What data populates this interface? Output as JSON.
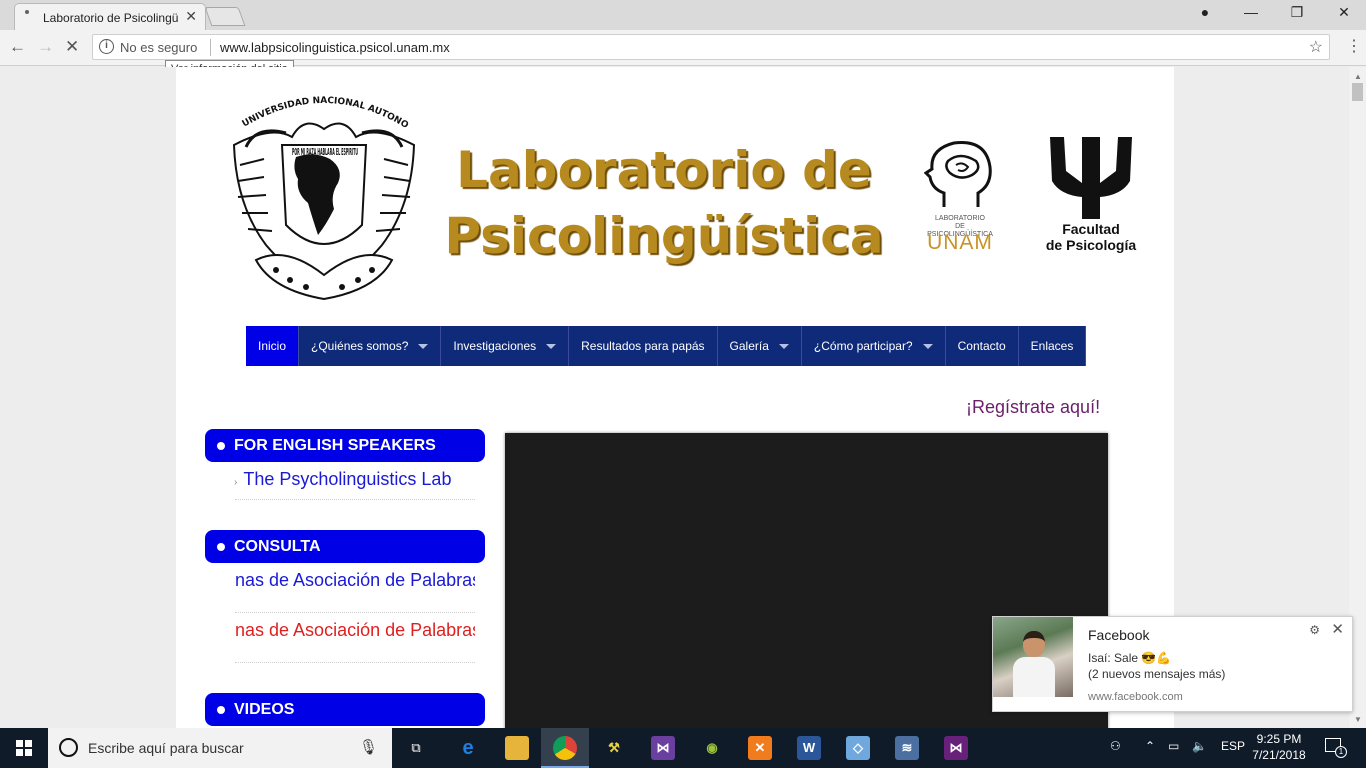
{
  "browser": {
    "tab_title": "Laboratorio de Psicolingü",
    "security_label": "No es seguro",
    "url": "www.labpsicolinguistica.psicol.unam.mx",
    "tooltip": "Ver información del sitio"
  },
  "header": {
    "title_line1": "Laboratorio de",
    "title_line2": "Psicolingüística",
    "seal_text_top": "UNIVERSIDAD NACIONAL AUTONOMA DE MEXICO",
    "seal_motto": "POR MI RAZA HABLARA EL ESPIRITU",
    "lab_logo_caption_line1": "LABORATORIO",
    "lab_logo_caption_line2": "DE PSICOLINGÜÍSTICA",
    "lab_logo_unam": "UNAM",
    "faculty_line1": "Facultad",
    "faculty_line2": "de Psicología"
  },
  "nav": {
    "items": [
      {
        "label": "Inicio"
      },
      {
        "label": "¿Quiénes somos?"
      },
      {
        "label": "Investigaciones"
      },
      {
        "label": "Resultados para papás"
      },
      {
        "label": "Galería"
      },
      {
        "label": "¿Cómo participar?"
      },
      {
        "label": "Contacto"
      },
      {
        "label": "Enlaces"
      }
    ]
  },
  "register_link": "¡Regístrate aquí!",
  "sidebar": {
    "english_heading": "FOR ENGLISH SPEAKERS",
    "english_link": "The Psycholinguistics Lab",
    "consulta_heading": "CONSULTA",
    "consulta_link1": "nas de Asociación de Palabras",
    "consulta_link2": "nas de Asociación de Palabras",
    "videos_heading": "VIDEOS"
  },
  "notification": {
    "app": "Facebook",
    "message": "Isaí: Sale 😎💪",
    "more": "(2 nuevos mensajes más)",
    "source": "www.facebook.com"
  },
  "taskbar": {
    "search_placeholder": "Escribe aquí para buscar",
    "language": "ESP",
    "time": "9:25 PM",
    "date": "7/21/2018",
    "notification_count": "1"
  },
  "colors": {
    "nav_bg": "#0f2a78",
    "nav_active": "#0000e6",
    "title_gold": "#b78a1f",
    "link_blue": "#1a1ad6",
    "link_red": "#e02020",
    "register_purple": "#6b1f6b"
  }
}
